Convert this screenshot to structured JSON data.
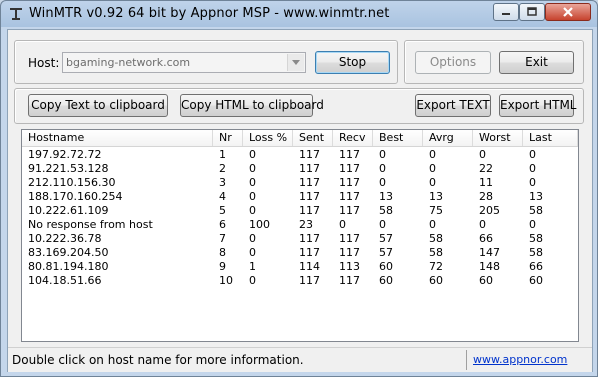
{
  "window": {
    "title": "WinMTR v0.92 64 bit by Appnor MSP - www.winmtr.net"
  },
  "host": {
    "label": "Host:",
    "value": "bgaming-network.com"
  },
  "buttons": {
    "stop": "Stop",
    "options": "Options",
    "exit": "Exit",
    "copy_text": "Copy Text to clipboard",
    "copy_html": "Copy HTML to clipboard",
    "export_text": "Export TEXT",
    "export_html": "Export HTML"
  },
  "table": {
    "columns": [
      "Hostname",
      "Nr",
      "Loss %",
      "Sent",
      "Recv",
      "Best",
      "Avrg",
      "Worst",
      "Last"
    ],
    "rows": [
      [
        "197.92.72.72",
        "1",
        "0",
        "117",
        "117",
        "0",
        "0",
        "0",
        "0"
      ],
      [
        "91.221.53.128",
        "2",
        "0",
        "117",
        "117",
        "0",
        "0",
        "22",
        "0"
      ],
      [
        "212.110.156.30",
        "3",
        "0",
        "117",
        "117",
        "0",
        "0",
        "11",
        "0"
      ],
      [
        "188.170.160.254",
        "4",
        "0",
        "117",
        "117",
        "13",
        "13",
        "28",
        "13"
      ],
      [
        "10.222.61.109",
        "5",
        "0",
        "117",
        "117",
        "58",
        "75",
        "205",
        "58"
      ],
      [
        "No response from host",
        "6",
        "100",
        "23",
        "0",
        "0",
        "0",
        "0",
        "0"
      ],
      [
        "10.222.36.78",
        "7",
        "0",
        "117",
        "117",
        "57",
        "58",
        "66",
        "58"
      ],
      [
        "83.169.204.50",
        "8",
        "0",
        "117",
        "117",
        "57",
        "58",
        "147",
        "58"
      ],
      [
        "80.81.194.180",
        "9",
        "1",
        "114",
        "113",
        "60",
        "72",
        "148",
        "66"
      ],
      [
        "104.18.51.66",
        "10",
        "0",
        "117",
        "117",
        "60",
        "60",
        "60",
        "60"
      ]
    ]
  },
  "status": {
    "message": "Double click on host name for more information.",
    "link": "www.appnor.com"
  },
  "icons": {
    "app": "winmtr-app-icon",
    "minimize": "minimize-icon",
    "maximize": "maximize-icon",
    "close": "close-icon",
    "dropdown": "chevron-down-icon"
  }
}
